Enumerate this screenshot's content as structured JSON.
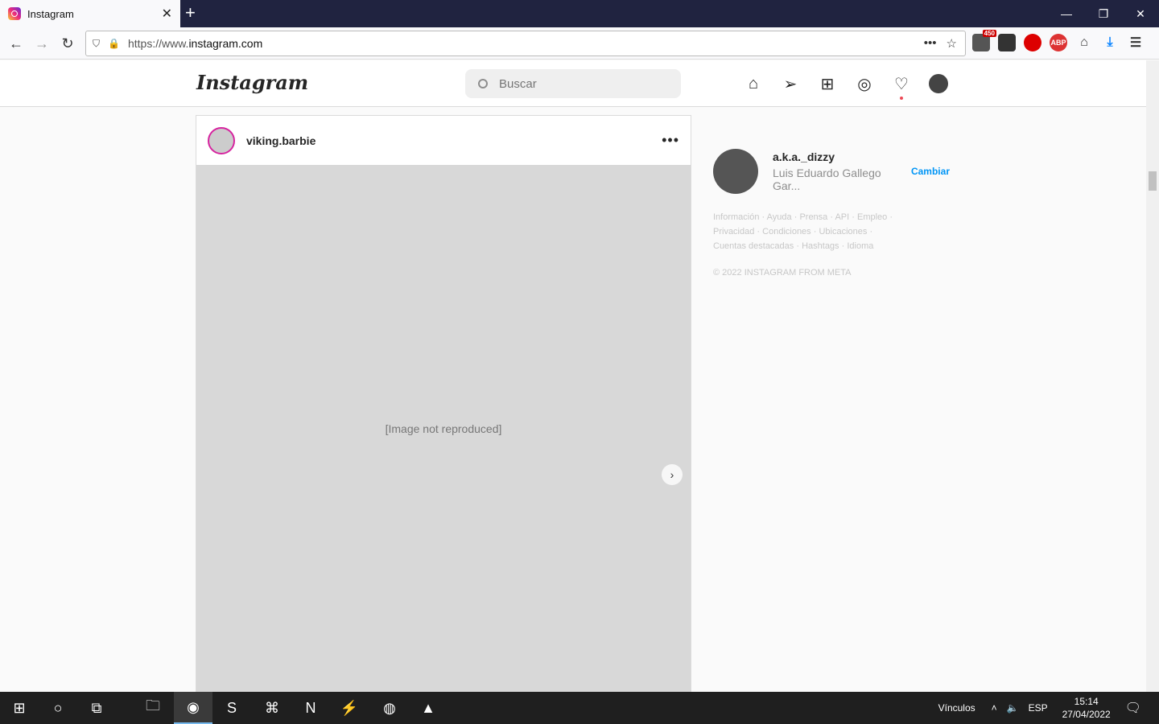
{
  "browser": {
    "tab_title": "Instagram",
    "url_prefix": "https://www.",
    "url_domain": "instagram.com",
    "badge_count": "450",
    "ext_abp": "ABP"
  },
  "instagram": {
    "logo": "Instagram",
    "search_placeholder": "Buscar",
    "post": {
      "username": "viking.barbie",
      "more": "•••",
      "media_placeholder": "[Image not reproduced]"
    },
    "sidebar": {
      "username": "a.k.a._dizzy",
      "fullname": "Luis Eduardo Gallego Gar...",
      "switch_label": "Cambiar",
      "links": [
        "Información",
        "Ayuda",
        "Prensa",
        "API",
        "Empleo",
        "Privacidad",
        "Condiciones",
        "Ubicaciones",
        "Cuentas destacadas",
        "Hashtags",
        "Idioma"
      ],
      "copyright": "© 2022 INSTAGRAM FROM META"
    }
  },
  "taskbar": {
    "links_label": "Vínculos",
    "lang": "ESP",
    "time": "15:14",
    "date": "27/04/2022"
  }
}
